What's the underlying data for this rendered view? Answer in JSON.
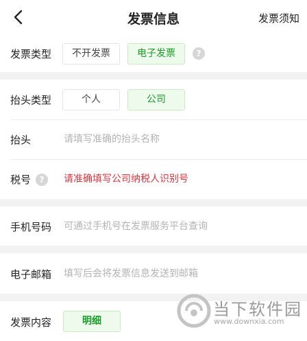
{
  "header": {
    "title": "发票信息",
    "notice_label": "发票须知"
  },
  "invoice_type": {
    "label": "发票类型",
    "options": [
      {
        "label": "不开发票",
        "selected": false
      },
      {
        "label": "电子发票",
        "selected": true
      }
    ],
    "help_icon": "question-icon"
  },
  "title_type": {
    "label": "抬头类型",
    "options": [
      {
        "label": "个人",
        "selected": false
      },
      {
        "label": "公司",
        "selected": true
      }
    ]
  },
  "title_field": {
    "label": "抬头",
    "value": "",
    "placeholder": "请填写准确的抬头名称"
  },
  "tax_field": {
    "label": "税号",
    "value": "",
    "placeholder": "请准确填写公司纳税人识别号",
    "help_icon": "question-icon"
  },
  "phone_field": {
    "label": "手机号码",
    "value": "",
    "placeholder": "可通过手机号在发票服务平台查询"
  },
  "email_field": {
    "label": "电子邮箱",
    "value": "",
    "placeholder": "填写后会将发票信息发送到邮箱"
  },
  "content": {
    "label": "发票内容",
    "options": [
      {
        "label": "明细",
        "selected": true
      }
    ]
  },
  "watermark": {
    "text": "当下软件园",
    "url": "www.downxia.com"
  },
  "colors": {
    "accent_green": "#1a9c2a",
    "selected_bg": "#eefaeb",
    "warning_red": "#d9363e",
    "background": "#f2f2f2"
  }
}
